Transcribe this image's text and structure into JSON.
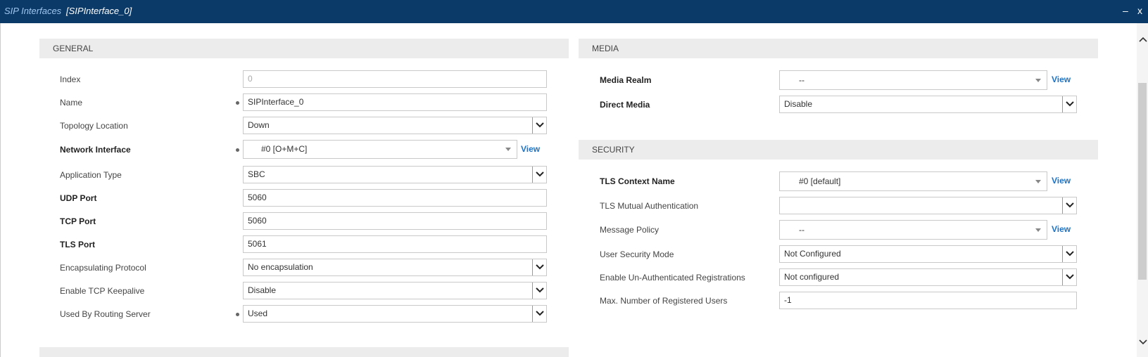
{
  "titlebar": {
    "path": "SIP Interfaces",
    "item": "[SIPInterface_0]",
    "minimize": "–",
    "close": "x"
  },
  "general": {
    "heading": "GENERAL",
    "index": {
      "label": "Index",
      "value": "0"
    },
    "name": {
      "label": "Name",
      "value": "SIPInterface_0"
    },
    "topology": {
      "label": "Topology Location",
      "value": "Down"
    },
    "network_interface": {
      "label": "Network Interface",
      "value": "#0 [O+M+C]",
      "link": "View"
    },
    "application_type": {
      "label": "Application Type",
      "value": "SBC"
    },
    "udp_port": {
      "label": "UDP Port",
      "value": "5060"
    },
    "tcp_port": {
      "label": "TCP Port",
      "value": "5060"
    },
    "tls_port": {
      "label": "TLS Port",
      "value": "5061"
    },
    "encapsulating": {
      "label": "Encapsulating Protocol",
      "value": "No encapsulation"
    },
    "keepalive": {
      "label": "Enable TCP Keepalive",
      "value": "Disable"
    },
    "routing_server": {
      "label": "Used By Routing Server",
      "value": "Used"
    }
  },
  "media": {
    "heading": "MEDIA",
    "realm": {
      "label": "Media Realm",
      "value": "--",
      "link": "View"
    },
    "direct": {
      "label": "Direct Media",
      "value": "Disable"
    }
  },
  "security": {
    "heading": "SECURITY",
    "tls_context": {
      "label": "TLS Context Name",
      "value": "#0 [default]",
      "link": "View"
    },
    "tls_mutual": {
      "label": "TLS Mutual Authentication",
      "value": ""
    },
    "message_policy": {
      "label": "Message Policy",
      "value": "--",
      "link": "View"
    },
    "user_security": {
      "label": "User Security Mode",
      "value": "Not Configured"
    },
    "unauth_reg": {
      "label": "Enable Un-Authenticated Registrations",
      "value": "Not configured"
    },
    "max_users": {
      "label": "Max. Number of Registered Users",
      "value": "-1"
    }
  },
  "colors": {
    "titlebar": "#0b3a68",
    "link": "#1a73c9",
    "section": "#ececec"
  },
  "icons": {
    "select_button": "chevron-down-icon",
    "scroll_up": "chevron-up-icon",
    "scroll_down": "chevron-down-icon"
  }
}
